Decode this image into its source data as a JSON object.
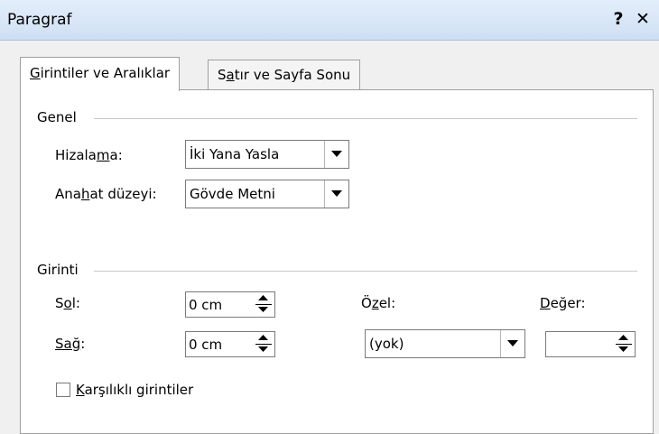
{
  "window": {
    "title": "Paragraf",
    "help_label": "?",
    "close_label": "✕"
  },
  "tabs": [
    {
      "label_ul": "G",
      "label_rest": "irintiler ve Aralıklar",
      "active": true
    },
    {
      "label_pre": "S",
      "label_ul": "a",
      "label_rest": "tır ve Sayfa Sonu",
      "active": false
    }
  ],
  "general": {
    "title": "Genel",
    "alignment": {
      "label_pre": "Hizala",
      "label_ul": "m",
      "label_rest": "a:",
      "value": "İki Yana Yasla"
    },
    "outline_level": {
      "label_pre": "Ana",
      "label_ul": "h",
      "label_rest": "at düzeyi:",
      "value": "Gövde Metni"
    }
  },
  "indentation": {
    "title": "Girinti",
    "left": {
      "label_pre": "S",
      "label_ul": "o",
      "label_rest": "l:",
      "value": "0 cm"
    },
    "right": {
      "label_ul": "Sağ",
      "label_rest": ":",
      "value": "0 cm"
    },
    "special": {
      "label_pre": "Ö",
      "label_ul": "z",
      "label_rest": "el:",
      "value": "(yok)"
    },
    "by": {
      "label_ul": "D",
      "label_rest": "eğer:",
      "value": ""
    },
    "mirror": {
      "label_ul": "K",
      "label_rest": "arşılıklı girintiler",
      "checked": false
    }
  }
}
